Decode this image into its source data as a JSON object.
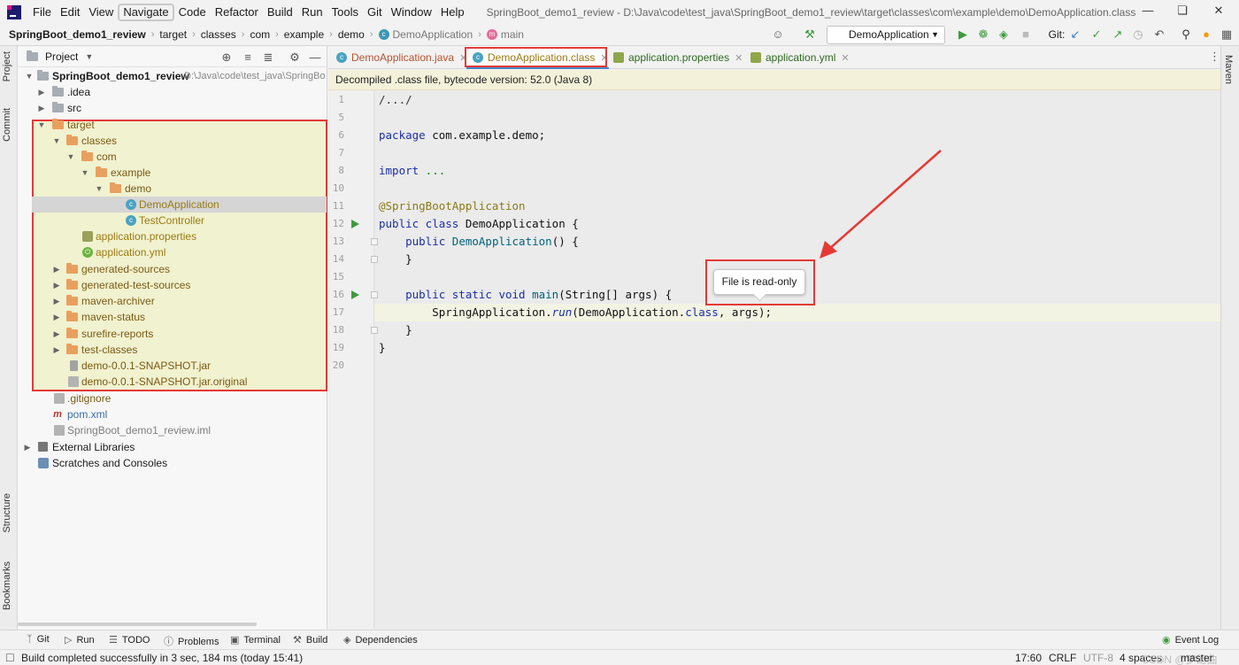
{
  "menubar": {
    "items": [
      "File",
      "Edit",
      "View",
      "Navigate",
      "Code",
      "Refactor",
      "Build",
      "Run",
      "Tools",
      "Git",
      "Window",
      "Help"
    ],
    "window_title": "SpringBoot_demo1_review - D:\\Java\\code\\test_java\\SpringBoot_demo1_review\\target\\classes\\com\\example\\demo\\DemoApplication.class"
  },
  "breadcrumb": {
    "items": [
      "SpringBoot_demo1_review",
      "target",
      "classes",
      "com",
      "example",
      "demo",
      "DemoApplication",
      "main"
    ]
  },
  "toolbar": {
    "run_config": "DemoApplication",
    "git_label": "Git:"
  },
  "left_stripe": {
    "project": "Project",
    "commit": "Commit",
    "structure": "Structure",
    "bookmarks": "Bookmarks"
  },
  "right_stripe": {
    "maven": "Maven"
  },
  "project_panel": {
    "title": "Project",
    "root": {
      "name": "SpringBoot_demo1_review",
      "path": "D:\\Java\\code\\test_java\\SpringBo"
    },
    "tree": [
      {
        "label": ".idea"
      },
      {
        "label": "src"
      },
      {
        "label": "target"
      },
      {
        "label": "classes"
      },
      {
        "label": "com"
      },
      {
        "label": "example"
      },
      {
        "label": "demo"
      },
      {
        "label": "DemoApplication"
      },
      {
        "label": "TestController"
      },
      {
        "label": "application.properties"
      },
      {
        "label": "application.yml"
      },
      {
        "label": "generated-sources"
      },
      {
        "label": "generated-test-sources"
      },
      {
        "label": "maven-archiver"
      },
      {
        "label": "maven-status"
      },
      {
        "label": "surefire-reports"
      },
      {
        "label": "test-classes"
      },
      {
        "label": "demo-0.0.1-SNAPSHOT.jar"
      },
      {
        "label": "demo-0.0.1-SNAPSHOT.jar.original"
      },
      {
        "label": ".gitignore"
      },
      {
        "label": "pom.xml"
      },
      {
        "label": "SpringBoot_demo1_review.iml"
      },
      {
        "label": "External Libraries"
      },
      {
        "label": "Scratches and Consoles"
      }
    ]
  },
  "editor_tabs": [
    {
      "label": "DemoApplication.java",
      "icon": "class-icon"
    },
    {
      "label": "DemoApplication.class",
      "icon": "class-icon"
    },
    {
      "label": "application.properties",
      "icon": "properties-icon"
    },
    {
      "label": "application.yml",
      "icon": "yml-icon"
    }
  ],
  "banner": {
    "text": "Decompiled .class file, bytecode version: 52.0 (Java 8)"
  },
  "editor": {
    "line_numbers": [
      "1",
      "5",
      "6",
      "7",
      "8",
      "10",
      "11",
      "12",
      "13",
      "14",
      "15",
      "16",
      "17",
      "18",
      "19",
      "20"
    ],
    "lines": {
      "l1": "/.../",
      "l6a": "package",
      "l6b": " com.example.demo;",
      "l8a": "import",
      "l8b": " ...",
      "l11": "@SpringBootApplication",
      "l12a": "public class",
      "l12b": " DemoApplication {",
      "l13a": "    public",
      "l13b": " DemoApplication",
      "l13c": "() {",
      "l14": "    }",
      "l16a": "    public static void",
      "l16b": " main",
      "l16c": "(String[] args) {",
      "l17a": "        SpringApplication.",
      "l17b": "run",
      "l17c": "(DemoApplication.",
      "l17d": "class",
      "l17e": ", args);",
      "l18": "    }",
      "l19": "}"
    }
  },
  "tooltip": {
    "text": "File is read-only"
  },
  "tool_windows": {
    "git": "Git",
    "run": "Run",
    "todo": "TODO",
    "problems": "Problems",
    "terminal": "Terminal",
    "build": "Build",
    "dependencies": "Dependencies",
    "event_log": "Event Log"
  },
  "status": {
    "message": "Build completed successfully in 3 sec, 184 ms (today 15:41)",
    "position": "17:60",
    "line_sep": "CRLF",
    "encoding": "UTF-8",
    "indent": "4 spaces",
    "watermark": "CSDN @梦幻曲",
    "branch": "master"
  },
  "colors": {
    "highlight_border": "#e53935",
    "target_highlight": "#e8eba0",
    "keyword": "#1a2ea8",
    "annotation": "#8a7a16"
  }
}
